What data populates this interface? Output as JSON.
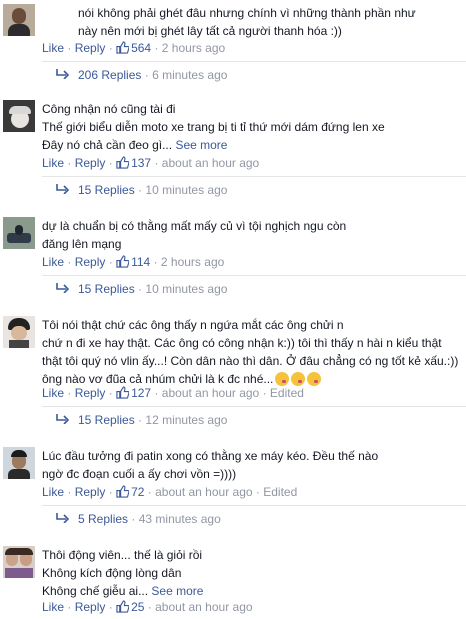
{
  "actions": {
    "like": "Like",
    "reply": "Reply",
    "dot": "·"
  },
  "comments": [
    {
      "text": "nói không phải ghét đâu nhưng chính vì những thành phần như\nnày nên mới bị ghét lây tất cả người thanh hóa :))",
      "likes": "564",
      "time": "2 hours ago",
      "replies": "206 Replies",
      "replies_time": "6 minutes ago"
    },
    {
      "text": "Công nhận nó cũng tài đi\nThế giới biểu diễn moto xe trang bị ti tỉ thứ mới dám đứng len xe\nĐây nó chả cần đeo gì...",
      "see_more": "See more",
      "likes": "137",
      "time": "about an hour ago",
      "replies": "15 Replies",
      "replies_time": "10 minutes ago"
    },
    {
      "text": "dự là chuẩn bị có thằng mất mấy củ vì tội nghịch ngu còn\nđăng lên mạng",
      "likes": "114",
      "time": "2 hours ago",
      "replies": "15 Replies",
      "replies_time": "10 minutes ago"
    },
    {
      "text": "Tôi nói thật chứ các ông thấy n ngứa mắt các ông chửi n\nchứ n đi xe hay thật. Các ông có công nhận k:)) tôi thì thấy n hài n kiểu thật\nthật tôi quý nó vlin ấy...! Còn dân nào thì dân. Ở đâu chẳng có ng tốt kẻ xấu.:))\nông nào vơ đũa cả nhúm chửi là k đc nhé...",
      "likes": "127",
      "time": "about an hour ago",
      "edited": "Edited",
      "replies": "15 Replies",
      "replies_time": "12 minutes ago"
    },
    {
      "text": "Lúc đầu tưởng đi patin xong có thằng xe máy kéo. Đều thế nào\nngờ đc đoạn cuối a ấy chơi vồn =))))",
      "likes": "72",
      "time": "about an hour ago",
      "edited": "Edited",
      "replies": "5 Replies",
      "replies_time": "43 minutes ago"
    },
    {
      "text": "Thôi động viên... thế là giỏi rồi\nKhông kích động lòng dân\nKhông chế giễu ai...",
      "see_more": "See more",
      "likes": "25",
      "time": "about an hour ago"
    }
  ],
  "colors": {
    "link": "#3b5998",
    "meta": "#9197a3",
    "text": "#141823"
  }
}
